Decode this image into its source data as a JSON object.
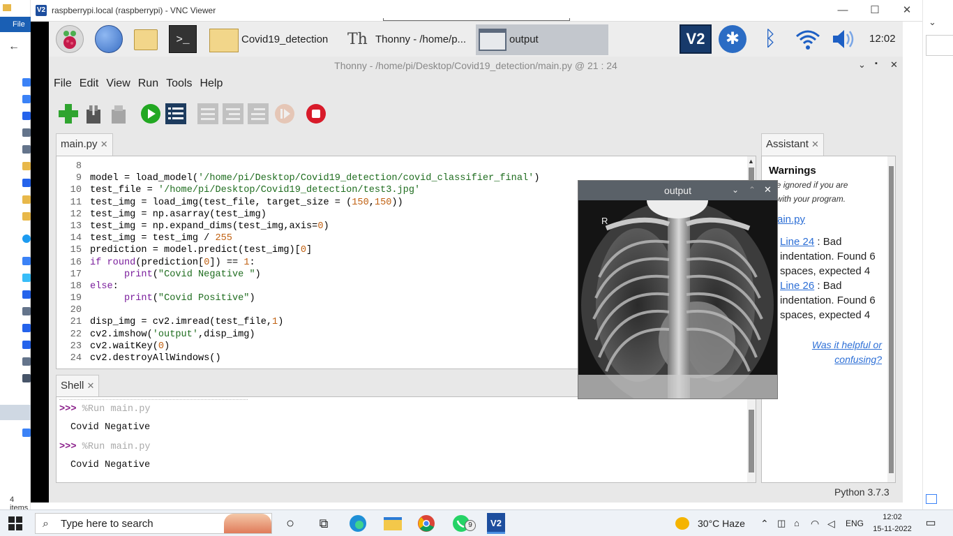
{
  "background_explorer": {
    "file_tab": "File",
    "status": "4 items"
  },
  "vnc": {
    "title": "raspberrypi.local (raspberrypi) - VNC Viewer",
    "logo": "V2"
  },
  "pi_panel": {
    "tasks": [
      "Covid19_detection",
      "Thonny  -  /home/p...",
      "output"
    ],
    "clock": "12:02"
  },
  "thonny": {
    "title": "Thonny  -  /home/pi/Desktop/Covid19_detection/main.py  @  21 : 24",
    "menu": [
      "File",
      "Edit",
      "View",
      "Run",
      "Tools",
      "Help"
    ],
    "editor_tab": "main.py",
    "shell_tab": "Shell",
    "assistant_tab": "Assistant",
    "python_version": "Python 3.7.3",
    "close_glyph": "✕"
  },
  "code_lines": [
    {
      "n": "8",
      "parts": [
        {
          "t": ""
        }
      ]
    },
    {
      "n": "9",
      "parts": [
        {
          "t": "model = load_model("
        },
        {
          "t": "'/home/pi/Desktop/Covid19_detection/covid_classifier_final'",
          "c": "str"
        },
        {
          "t": ")"
        }
      ]
    },
    {
      "n": "10",
      "parts": [
        {
          "t": "test_file = "
        },
        {
          "t": "'/home/pi/Desktop/Covid19_detection/test3.jpg'",
          "c": "str"
        }
      ]
    },
    {
      "n": "11",
      "parts": [
        {
          "t": "test_img = load_img(test_file, target_size = ("
        },
        {
          "t": "150",
          "c": "num"
        },
        {
          "t": ","
        },
        {
          "t": "150",
          "c": "num"
        },
        {
          "t": "))"
        }
      ]
    },
    {
      "n": "12",
      "parts": [
        {
          "t": "test_img = np.asarray(test_img)"
        }
      ]
    },
    {
      "n": "13",
      "parts": [
        {
          "t": "test_img = np.expand_dims(test_img,axis="
        },
        {
          "t": "0",
          "c": "num"
        },
        {
          "t": ")"
        }
      ]
    },
    {
      "n": "14",
      "parts": [
        {
          "t": "test_img = test_img / "
        },
        {
          "t": "255",
          "c": "num"
        }
      ]
    },
    {
      "n": "15",
      "parts": [
        {
          "t": "prediction = model.predict(test_img)["
        },
        {
          "t": "0",
          "c": "num"
        },
        {
          "t": "]"
        }
      ]
    },
    {
      "n": "16",
      "parts": [
        {
          "t": "if",
          "c": "kw"
        },
        {
          "t": " "
        },
        {
          "t": "round",
          "c": "kw"
        },
        {
          "t": "(prediction["
        },
        {
          "t": "0",
          "c": "num"
        },
        {
          "t": "]) == "
        },
        {
          "t": "1",
          "c": "num"
        },
        {
          "t": ":"
        }
      ]
    },
    {
      "n": "17",
      "parts": [
        {
          "t": "      "
        },
        {
          "t": "print",
          "c": "kw"
        },
        {
          "t": "("
        },
        {
          "t": "\"Covid Negative \"",
          "c": "str"
        },
        {
          "t": ")"
        }
      ]
    },
    {
      "n": "18",
      "parts": [
        {
          "t": "else",
          "c": "kw"
        },
        {
          "t": ":"
        }
      ]
    },
    {
      "n": "19",
      "parts": [
        {
          "t": "      "
        },
        {
          "t": "print",
          "c": "kw"
        },
        {
          "t": "("
        },
        {
          "t": "\"Covid Positive\"",
          "c": "str"
        },
        {
          "t": ")"
        }
      ]
    },
    {
      "n": "20",
      "parts": [
        {
          "t": ""
        }
      ]
    },
    {
      "n": "21",
      "parts": [
        {
          "t": "disp_img = cv2.imread(test_file,"
        },
        {
          "t": "1",
          "c": "num"
        },
        {
          "t": ")"
        }
      ]
    },
    {
      "n": "22",
      "parts": [
        {
          "t": "cv2.imshow("
        },
        {
          "t": "'output'",
          "c": "str"
        },
        {
          "t": ",disp_img)"
        }
      ]
    },
    {
      "n": "23",
      "parts": [
        {
          "t": "cv2.waitKey("
        },
        {
          "t": "0",
          "c": "num"
        },
        {
          "t": ")"
        }
      ]
    },
    {
      "n": "24",
      "parts": [
        {
          "t": "cv2.destroyAllWindows()"
        }
      ]
    }
  ],
  "shell": {
    "prompt": ">>>",
    "cmd1": "%Run main.py",
    "out1": "Covid Negative",
    "cmd2": "%Run main.py",
    "out2": "Covid Negative"
  },
  "assistant": {
    "heading": "Warnings",
    "intro_l1": "ay be ignored if you are",
    "intro_l2": "ppy with your program.",
    "file_link": "ain.py",
    "w1_link": "Line 24",
    "w1_l1": ": Bad",
    "w1_l2": "indentation. Found 6",
    "w1_l3": "spaces, expected 4",
    "w2_link": "Line 26",
    "w2_l1": ": Bad",
    "w2_l2": "indentation. Found 6",
    "w2_l3": "spaces, expected 4",
    "feedback_l1": "Was it helpful or",
    "feedback_l2": "confusing?"
  },
  "output_window": {
    "title": "output",
    "marker": "R"
  },
  "taskbar": {
    "search_placeholder": "Type here to search",
    "whatsapp_badge": "9",
    "weather": "30°C  Haze",
    "lang": "ENG",
    "time": "12:02",
    "date": "15-11-2022"
  }
}
